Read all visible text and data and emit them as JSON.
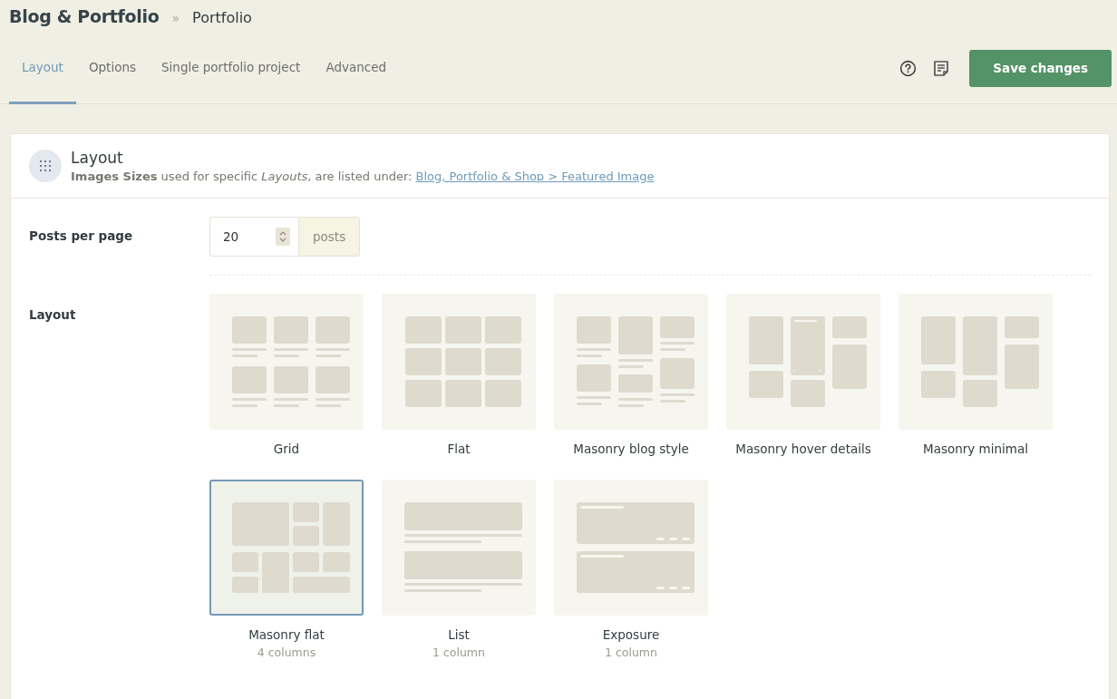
{
  "breadcrumb": {
    "parent": "Blog & Portfolio",
    "separator": "»",
    "current": "Portfolio"
  },
  "tabs": [
    {
      "label": "Layout",
      "selected": true
    },
    {
      "label": "Options",
      "selected": false
    },
    {
      "label": "Single portfolio project",
      "selected": false
    },
    {
      "label": "Advanced",
      "selected": false
    }
  ],
  "save_button": "Save changes",
  "section": {
    "title": "Layout",
    "description": "**Images Sizes** used for specific *Layouts*, are listed under: ",
    "link": "Blog, Portfolio & Shop > Featured Image"
  },
  "posts_per_page": {
    "label": "Posts per page",
    "value": "20",
    "unit": "posts"
  },
  "layout": {
    "label": "Layout",
    "options": [
      {
        "kind": "grid",
        "name": "Grid",
        "selected": false
      },
      {
        "kind": "flat",
        "name": "Flat",
        "selected": false
      },
      {
        "kind": "masonry-blog",
        "name": "Masonry blog style",
        "selected": false
      },
      {
        "kind": "masonry-hover",
        "name": "Masonry hover details",
        "selected": false
      },
      {
        "kind": "masonry-minimal",
        "name": "Masonry minimal",
        "selected": false
      },
      {
        "kind": "masonry-flat",
        "name": "Masonry flat",
        "note": "4 columns",
        "selected": true
      },
      {
        "kind": "list",
        "name": "List",
        "note": "1 column",
        "selected": false
      },
      {
        "kind": "exposure",
        "name": "Exposure",
        "note": "1 column",
        "selected": false
      }
    ]
  }
}
